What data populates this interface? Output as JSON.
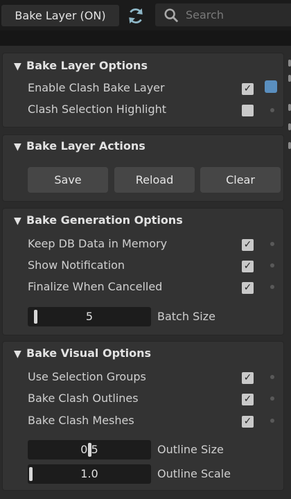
{
  "toolbar": {
    "title": "Bake Layer (ON)",
    "search_placeholder": "Search"
  },
  "sections": {
    "options": {
      "title": "Bake Layer Options",
      "items": [
        {
          "label": "Enable Clash Bake Layer",
          "checked": true
        },
        {
          "label": "Clash Selection Highlight",
          "checked": false
        }
      ]
    },
    "actions": {
      "title": "Bake Layer Actions",
      "buttons": [
        "Save",
        "Reload",
        "Clear"
      ]
    },
    "generation": {
      "title": "Bake Generation Options",
      "items": [
        {
          "label": "Keep DB Data in Memory",
          "checked": true
        },
        {
          "label": "Show Notification",
          "checked": true
        },
        {
          "label": "Finalize When Cancelled",
          "checked": true
        }
      ],
      "batch_size": {
        "value": "5",
        "label": "Batch Size"
      }
    },
    "visual": {
      "title": "Bake Visual Options",
      "items": [
        {
          "label": "Use Selection Groups",
          "checked": true
        },
        {
          "label": "Bake Clash Outlines",
          "checked": true
        },
        {
          "label": "Bake Clash Meshes",
          "checked": true
        }
      ],
      "outline_size": {
        "value": "0.5",
        "label": "Outline Size"
      },
      "outline_scale": {
        "value": "1.0",
        "label": "Outline Scale"
      }
    }
  },
  "checkmark": "✓",
  "colors": {
    "accent": "#5a8fbf",
    "refresh": "#8fb8c8"
  },
  "icons": [
    "refresh-icon",
    "search-icon",
    "collapse-triangle-icon",
    "checkbox",
    "dot-icon"
  ]
}
